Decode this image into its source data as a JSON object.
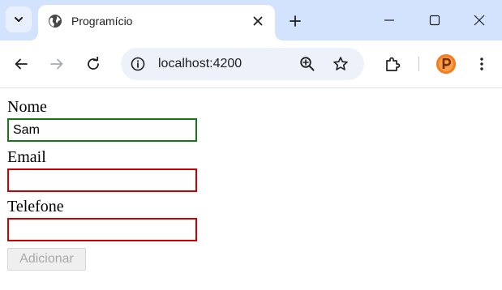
{
  "browser": {
    "tab": {
      "title": "Programício"
    },
    "address_bar": {
      "url": "localhost:4200"
    },
    "profile_initial": "P"
  },
  "form": {
    "fields": [
      {
        "label": "Nome",
        "value": "Sam",
        "state": "valid",
        "border_color": "#137a13"
      },
      {
        "label": "Email",
        "value": "",
        "state": "invalid",
        "border_color": "#cc0000"
      },
      {
        "label": "Telefone",
        "value": "",
        "state": "invalid",
        "border_color": "#cc0000"
      }
    ],
    "submit": {
      "label": "Adicionar",
      "disabled": true
    }
  },
  "colors": {
    "tabstrip_bg": "#d3e3fd",
    "omnibox_bg": "#edf2fa",
    "valid_border": "#137a13",
    "invalid_border": "#cc0000",
    "profile_accent": "#f57c1f"
  },
  "icons": {
    "tab_search": "chevron-down-icon",
    "favicon": "globe-icon",
    "tab_close": "close-icon",
    "new_tab": "plus-icon",
    "minimize": "minimize-icon",
    "maximize": "maximize-icon",
    "close_window": "close-icon",
    "back": "arrow-left-icon",
    "forward": "arrow-right-icon",
    "reload": "reload-icon",
    "site_info": "info-icon",
    "zoom": "zoom-in-icon",
    "bookmark": "star-icon",
    "extensions": "puzzle-icon",
    "menu": "kebab-menu-icon"
  }
}
